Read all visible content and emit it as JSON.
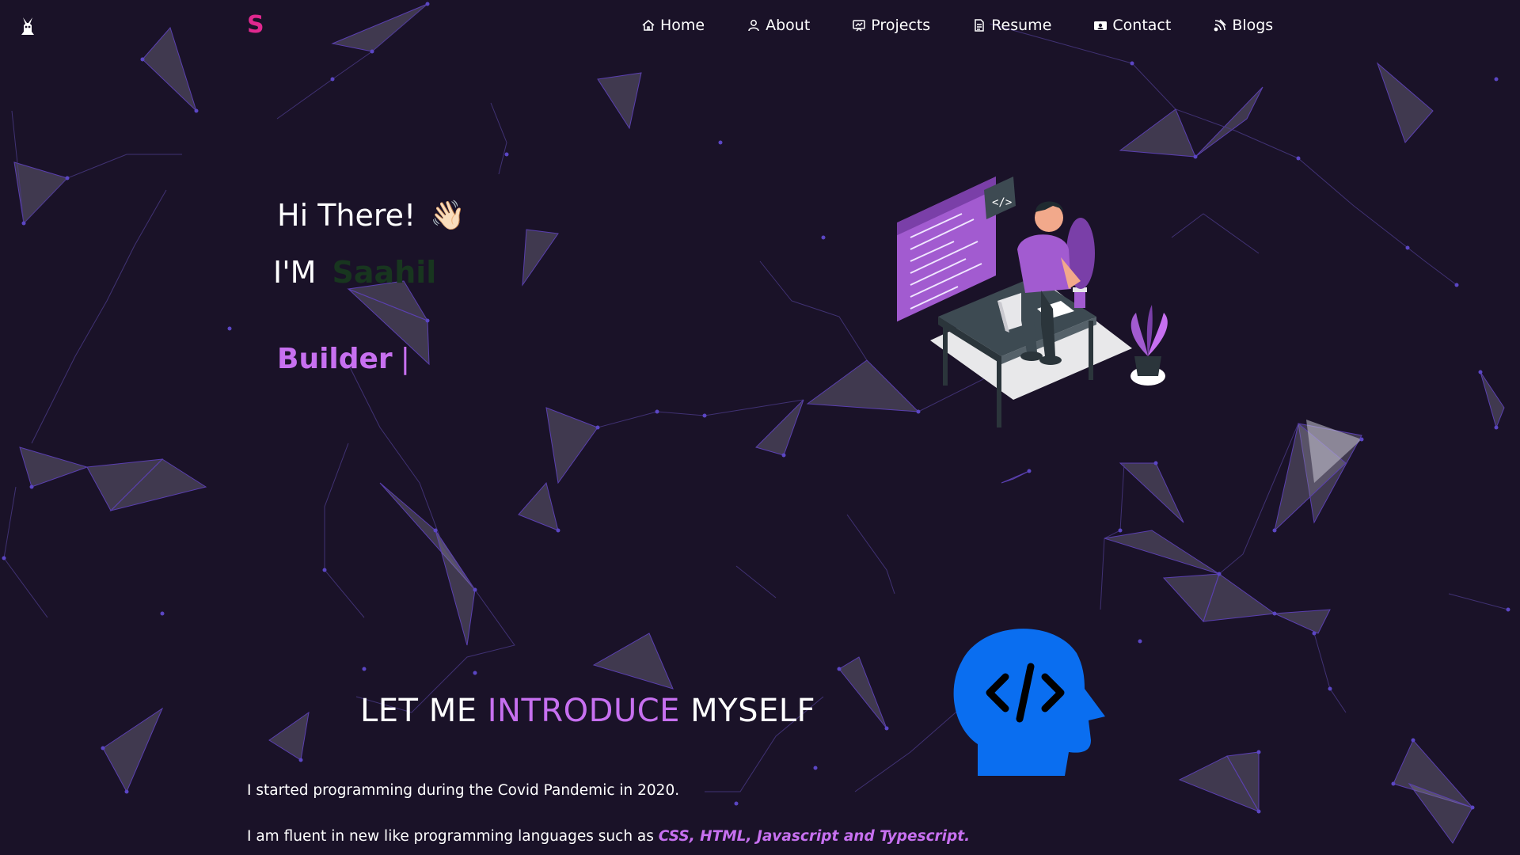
{
  "nav": {
    "logo": "S",
    "items": [
      {
        "label": "Home",
        "icon": "home-icon"
      },
      {
        "label": "About",
        "icon": "user-icon"
      },
      {
        "label": "Projects",
        "icon": "projects-icon"
      },
      {
        "label": "Resume",
        "icon": "document-icon"
      },
      {
        "label": "Contact",
        "icon": "contact-icon"
      },
      {
        "label": "Blogs",
        "icon": "blog-icon"
      }
    ]
  },
  "hero": {
    "greeting": "Hi There!",
    "wave": "👋🏻",
    "im_prefix": "I'M",
    "name": "Saahil",
    "typed_text": "Builder",
    "cursor": "|"
  },
  "intro": {
    "heading_part1": "LET ME",
    "heading_accent": "INTRODUCE",
    "heading_part2": "MYSELF",
    "p1": "I started programming during the Covid Pandemic in 2020.",
    "p2_prefix": "I am fluent in new like programming languages such as",
    "p2_highlight": "CSS, HTML, Javascript and Typescript."
  },
  "colors": {
    "background": "#1a1228",
    "accent": "#c770f0",
    "logo": "#e0288f",
    "head_icon": "#0a6ef0"
  }
}
